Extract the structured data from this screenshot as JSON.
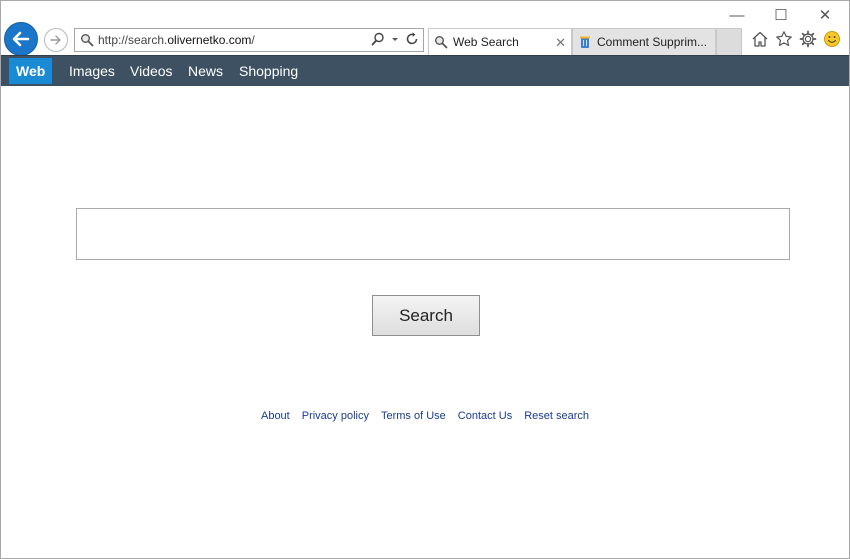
{
  "browser": {
    "address_url_prefix": "http://search.",
    "address_url_domain": "olivernetko.com",
    "address_url_suffix": "/",
    "tabs": [
      {
        "label": "Web Search",
        "active": true,
        "close_label": "✕"
      },
      {
        "label": "Comment Supprim...",
        "active": false
      }
    ],
    "window_controls": {
      "minimize": "—",
      "maximize": "☐",
      "close": "✕"
    },
    "toolbar_icons": [
      "home-icon",
      "star-icon",
      "gear-icon",
      "smiley-icon"
    ]
  },
  "nav": {
    "items": [
      {
        "label": "Web",
        "active": true
      },
      {
        "label": "Images",
        "active": false
      },
      {
        "label": "Videos",
        "active": false
      },
      {
        "label": "News",
        "active": false
      },
      {
        "label": "Shopping",
        "active": false
      }
    ]
  },
  "search": {
    "input_value": "",
    "button_label": "Search"
  },
  "footer": {
    "links": [
      "About",
      "Privacy policy",
      "Terms of Use",
      "Contact Us",
      "Reset search"
    ]
  },
  "colors": {
    "nav_bg": "#3e5163",
    "nav_active": "#1a8ad4",
    "back_button": "#1b75c9",
    "link": "#1a3b8f"
  }
}
